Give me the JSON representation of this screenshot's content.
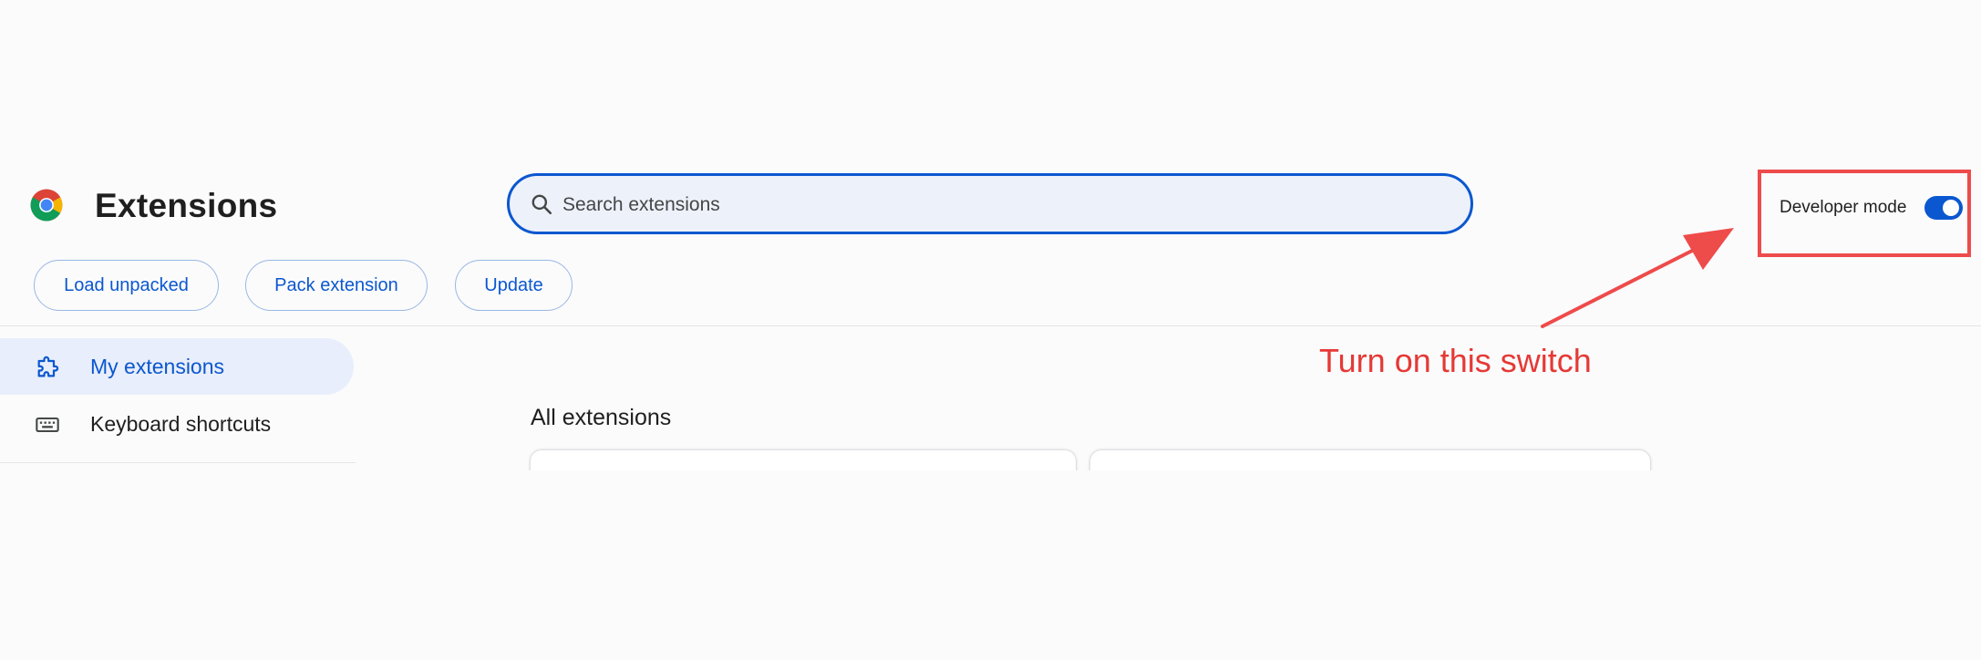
{
  "header": {
    "title": "Extensions",
    "logo_icon": "chrome-logo-icon"
  },
  "search": {
    "placeholder": "Search extensions",
    "value": "",
    "icon": "search-icon"
  },
  "developer_mode": {
    "label": "Developer mode",
    "enabled": true
  },
  "toolbar": {
    "load_unpacked_label": "Load unpacked",
    "pack_extension_label": "Pack extension",
    "update_label": "Update"
  },
  "sidebar": {
    "items": [
      {
        "label": "My extensions",
        "icon": "puzzle-piece-icon",
        "active": true
      },
      {
        "label": "Keyboard shortcuts",
        "icon": "keyboard-icon",
        "active": false
      }
    ]
  },
  "main": {
    "section_title": "All extensions"
  },
  "annotation": {
    "text": "Turn on this switch",
    "color": "#e53935"
  },
  "colors": {
    "accent": "#0b57d0",
    "active_nav_bg": "#e8eefb",
    "search_bg": "#edf1fa",
    "annotation_red": "#ee4b4b"
  }
}
